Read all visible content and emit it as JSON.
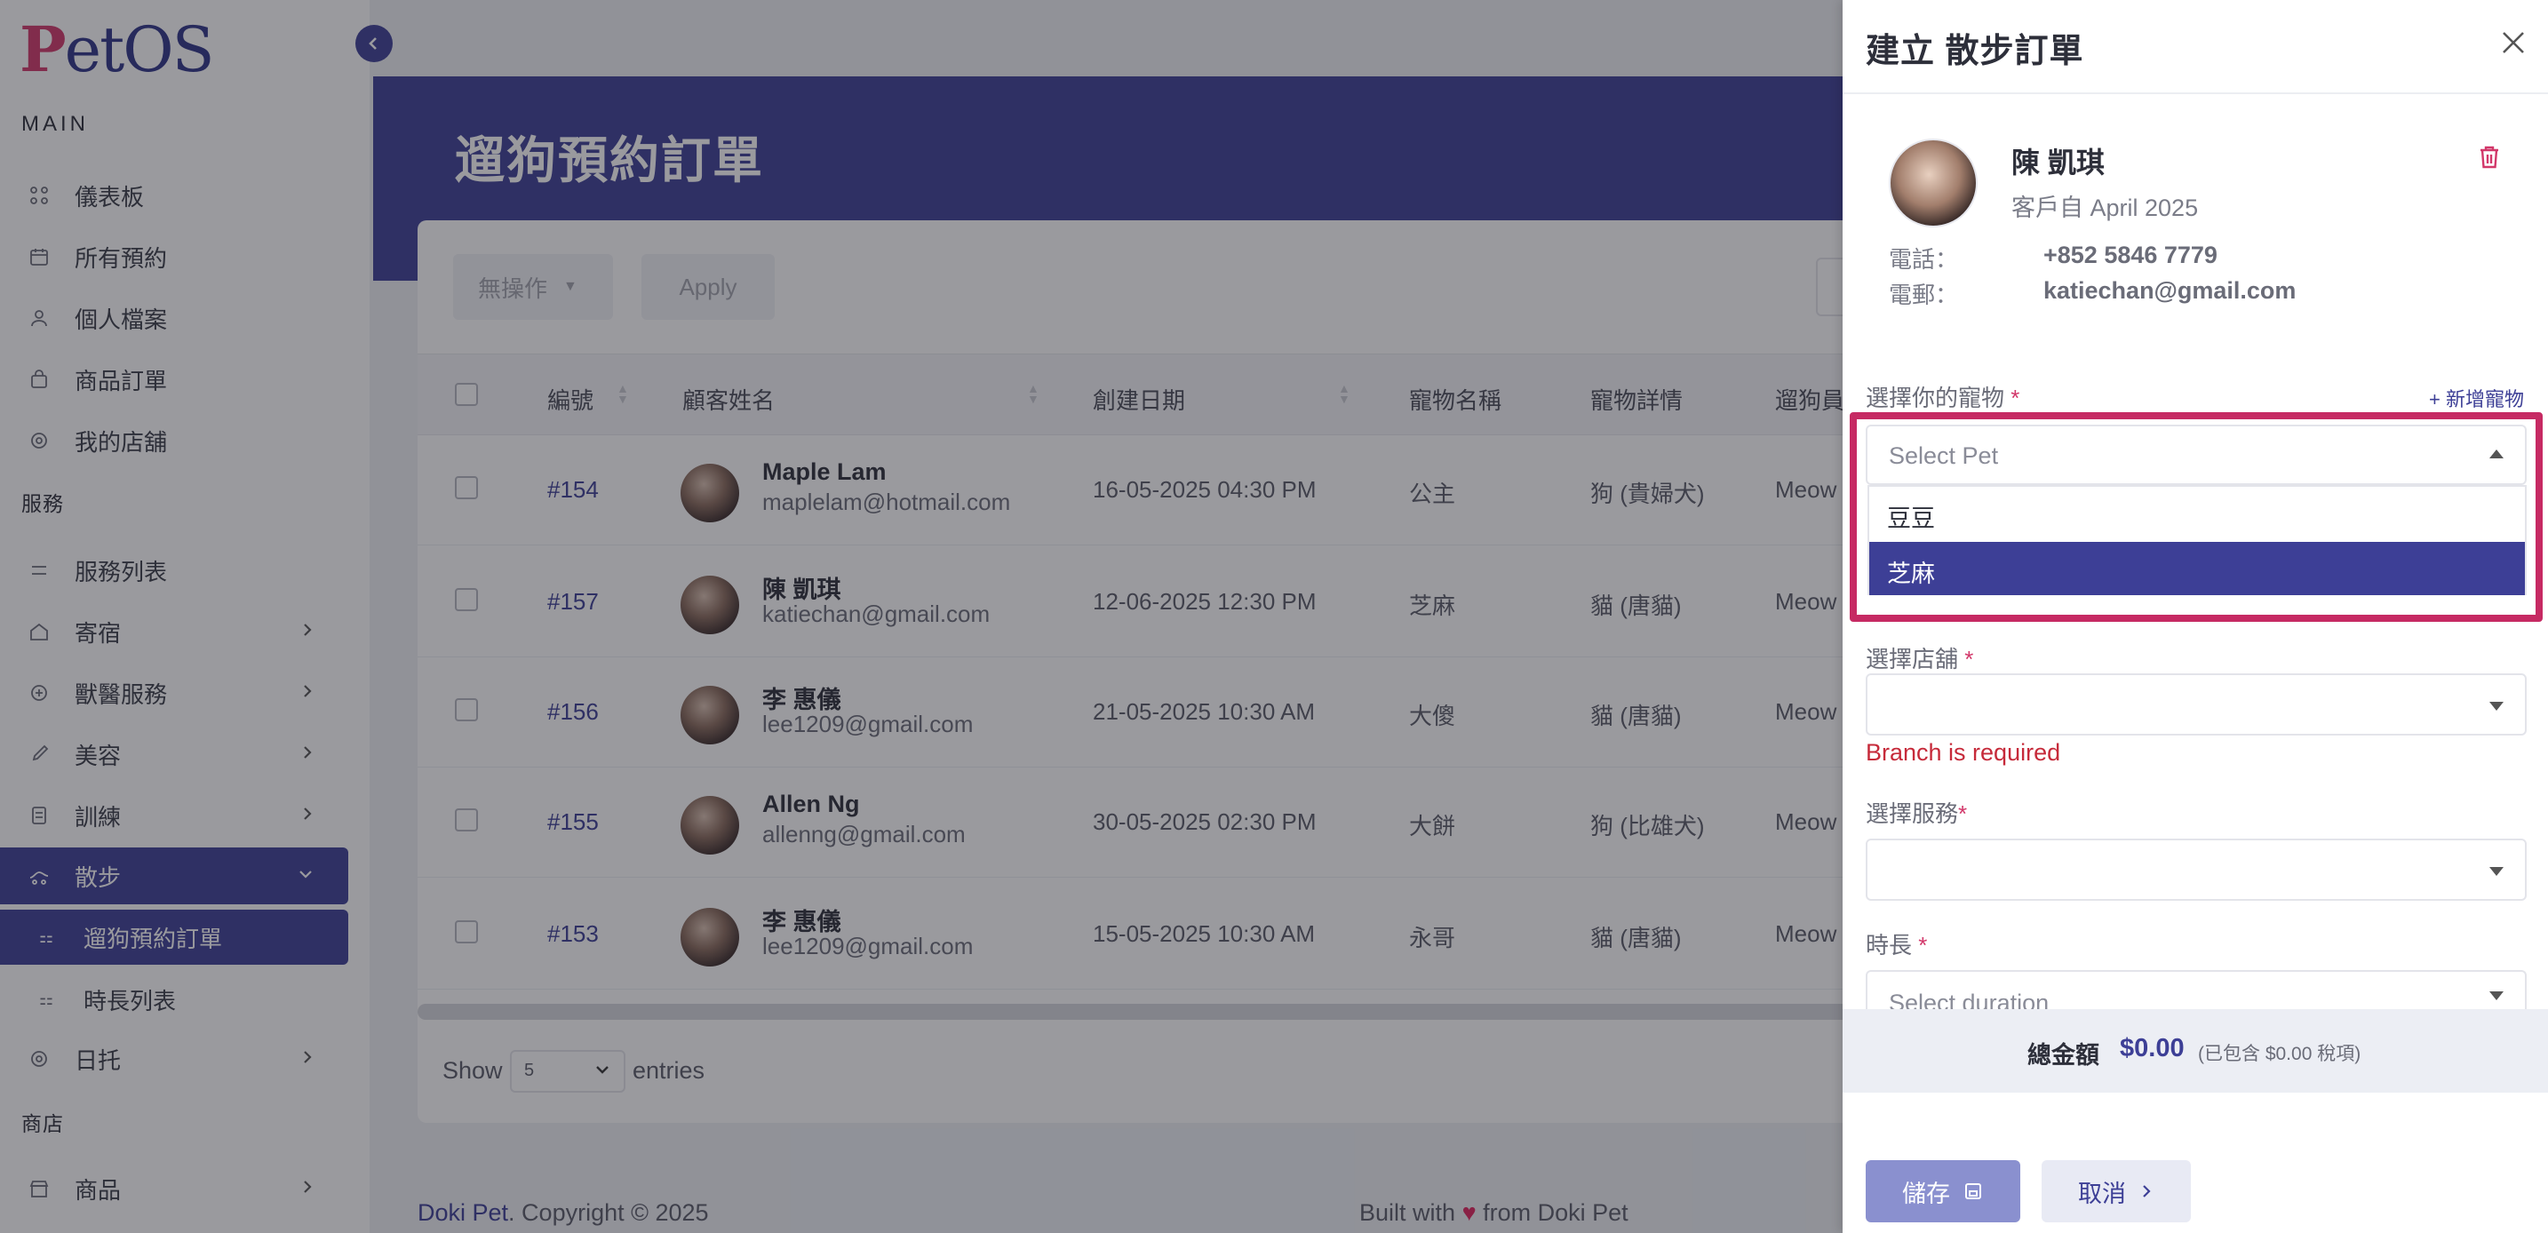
{
  "app": {
    "logo": "PetOS"
  },
  "sidebar": {
    "section_main": "MAIN",
    "main_items": [
      {
        "label": "儀表板",
        "icon": "dashboard-icon"
      },
      {
        "label": "所有預約",
        "icon": "calendar-icon"
      },
      {
        "label": "個人檔案",
        "icon": "user-icon"
      },
      {
        "label": "商品訂單",
        "icon": "bag-icon"
      },
      {
        "label": "我的店舖",
        "icon": "store-icon"
      }
    ],
    "section_services": "服務",
    "service_items": [
      {
        "label": "服務列表",
        "icon": "list-icon"
      },
      {
        "label": "寄宿",
        "icon": "house-icon"
      },
      {
        "label": "獸醫服務",
        "icon": "vet-icon"
      },
      {
        "label": "美容",
        "icon": "brush-icon"
      },
      {
        "label": "訓練",
        "icon": "training-icon"
      },
      {
        "label": "散步",
        "icon": "walk-icon"
      },
      {
        "label": "遛狗預約訂單",
        "icon": "sub-list-icon"
      },
      {
        "label": "時長列表",
        "icon": "sub-list-icon"
      },
      {
        "label": "日托",
        "icon": "daycare-icon"
      }
    ],
    "section_shop": "商店",
    "shop_items": [
      {
        "label": "商品",
        "icon": "shop-icon"
      }
    ]
  },
  "page": {
    "title": "遛狗預約訂單",
    "bulk_action": "無操作",
    "apply": "Apply",
    "columns": [
      "編號",
      "顧客姓名",
      "創建日期",
      "寵物名稱",
      "寵物詳情",
      "遛狗員"
    ],
    "rows": [
      {
        "id": "#154",
        "name": "Maple Lam",
        "email": "maplelam@hotmail.com",
        "date": "16-05-2025 04:30 PM",
        "pet": "公主",
        "detail": "狗 (貴婦犬)",
        "walker": "Meow"
      },
      {
        "id": "#157",
        "name": "陳 凱琪",
        "email": "katiechan@gmail.com",
        "date": "12-06-2025 12:30 PM",
        "pet": "芝麻",
        "detail": "貓 (唐貓)",
        "walker": "Meow"
      },
      {
        "id": "#156",
        "name": "李 惠儀",
        "email": "lee1209@gmail.com",
        "date": "21-05-2025 10:30 AM",
        "pet": "大傻",
        "detail": "貓 (唐貓)",
        "walker": "Meow"
      },
      {
        "id": "#155",
        "name": "Allen Ng",
        "email": "allenng@gmail.com",
        "date": "30-05-2025 02:30 PM",
        "pet": "大餅",
        "detail": "狗 (比雄犬)",
        "walker": "Meow"
      },
      {
        "id": "#153",
        "name": "李 惠儀",
        "email": "lee1209@gmail.com",
        "date": "15-05-2025 10:30 AM",
        "pet": "永哥",
        "detail": "貓 (唐貓)",
        "walker": "Meow"
      }
    ],
    "show": "Show",
    "page_size": "5",
    "entries": "entries"
  },
  "footer": {
    "brand": "Doki Pet",
    "copyright": ". Copyright © 2025",
    "built_prefix": "Built with",
    "built_suffix": "from Doki Pet"
  },
  "drawer": {
    "title": "建立 散步訂單",
    "customer": {
      "name": "陳 凱琪",
      "since": "客戶自 April 2025",
      "phone_label": "電話：",
      "phone": "+852 5846 7779",
      "email_label": "電郵：",
      "email": "katiechan@gmail.com"
    },
    "pet_label": "選擇你的寵物",
    "add_pet": "+ 新增寵物",
    "pet_placeholder": "Select Pet",
    "pet_options": [
      "豆豆",
      "芝麻"
    ],
    "pet_highlighted": "芝麻",
    "branch_label": "選擇店舖",
    "branch_error": "Branch is required",
    "service_label": "選擇服務",
    "duration_label": "時長",
    "duration_placeholder": "Select duration",
    "required_mark": "*",
    "total_label": "總金額",
    "total_value": "$0.00",
    "tax_note": "(已包含 $0.00 稅項)",
    "save": "儲存",
    "cancel": "取消"
  },
  "colors": {
    "primary": "#3d3f96",
    "accent": "#d2386a",
    "error": "#c62a3a"
  }
}
